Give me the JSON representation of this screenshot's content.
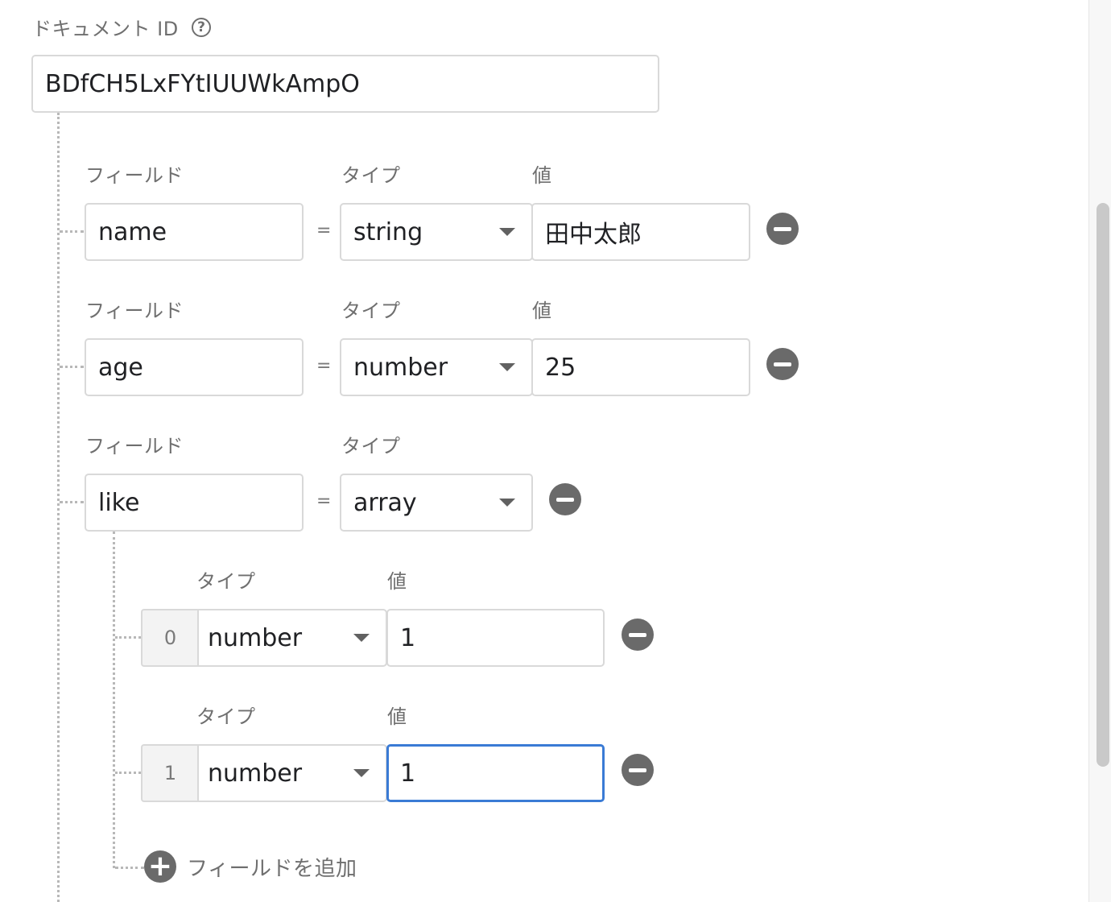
{
  "document_id": {
    "label": "ドキュメント ID",
    "help_icon": "help-circle-icon",
    "value": "BDfCH5LxFYtIUUWkAmpO"
  },
  "column_labels": {
    "field": "フィールド",
    "type": "タイプ",
    "value": "値"
  },
  "equals_sign": "=",
  "fields": [
    {
      "name": "name",
      "type": "string",
      "value": "田中太郎"
    },
    {
      "name": "age",
      "type": "number",
      "value": "25"
    },
    {
      "name": "like",
      "type": "array"
    }
  ],
  "array_items": [
    {
      "index": "0",
      "type": "number",
      "value": "1"
    },
    {
      "index": "1",
      "type": "number",
      "value": "1",
      "focused": true
    }
  ],
  "add_field": {
    "label": "フィールドを追加",
    "icon": "plus-circle-icon"
  },
  "icons": {
    "remove": "minus-circle-icon",
    "dropdown": "dropdown-arrow-icon"
  },
  "colors": {
    "focus_border": "#3a7bd5",
    "icon_gray": "#6a6a6a",
    "border": "#d9d9d9"
  }
}
